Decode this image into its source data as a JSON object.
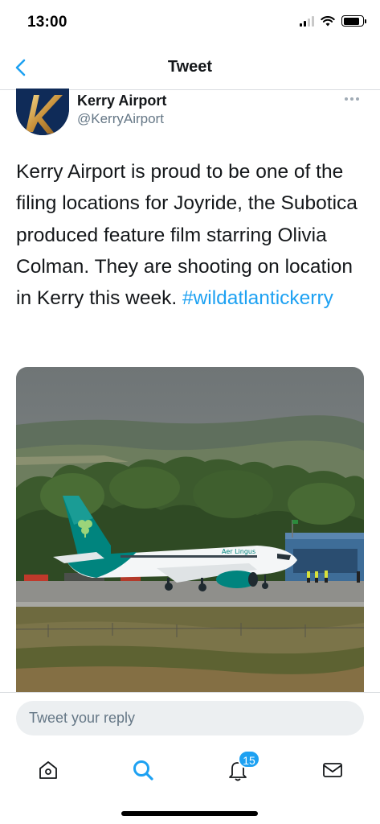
{
  "status_bar": {
    "time": "13:00",
    "signal_bars": 4,
    "signal_bars_active": 2,
    "battery_level": 0.85
  },
  "nav": {
    "title": "Tweet",
    "back_icon": "chevron-left-icon"
  },
  "tweet": {
    "author": {
      "name": "Kerry Airport",
      "handle": "@KerryAirport",
      "avatar_letter": "K"
    },
    "text": "Kerry Airport is proud to be one of the filing locations for Joyride, the Subotica produced feature film starring Olivia Colman. They are shooting on location in Kerry this week. ",
    "hashtag": "#wildatlantickerry",
    "more_icon": "ellipsis-icon",
    "media": {
      "aircraft_livery_text": "Aer Lingus"
    }
  },
  "reply": {
    "placeholder": "Tweet your reply"
  },
  "tab_bar": {
    "items": [
      {
        "name": "home",
        "icon": "home-icon"
      },
      {
        "name": "search",
        "icon": "search-icon",
        "active": true
      },
      {
        "name": "notifications",
        "icon": "bell-icon",
        "badge": "15"
      },
      {
        "name": "messages",
        "icon": "mail-icon"
      }
    ]
  },
  "colors": {
    "accent": "#1da1f2",
    "text_primary": "#14171a",
    "text_secondary": "#657786",
    "divider": "#dadde1",
    "reply_bg": "#eceff1",
    "tail_teal": "#00847e"
  }
}
